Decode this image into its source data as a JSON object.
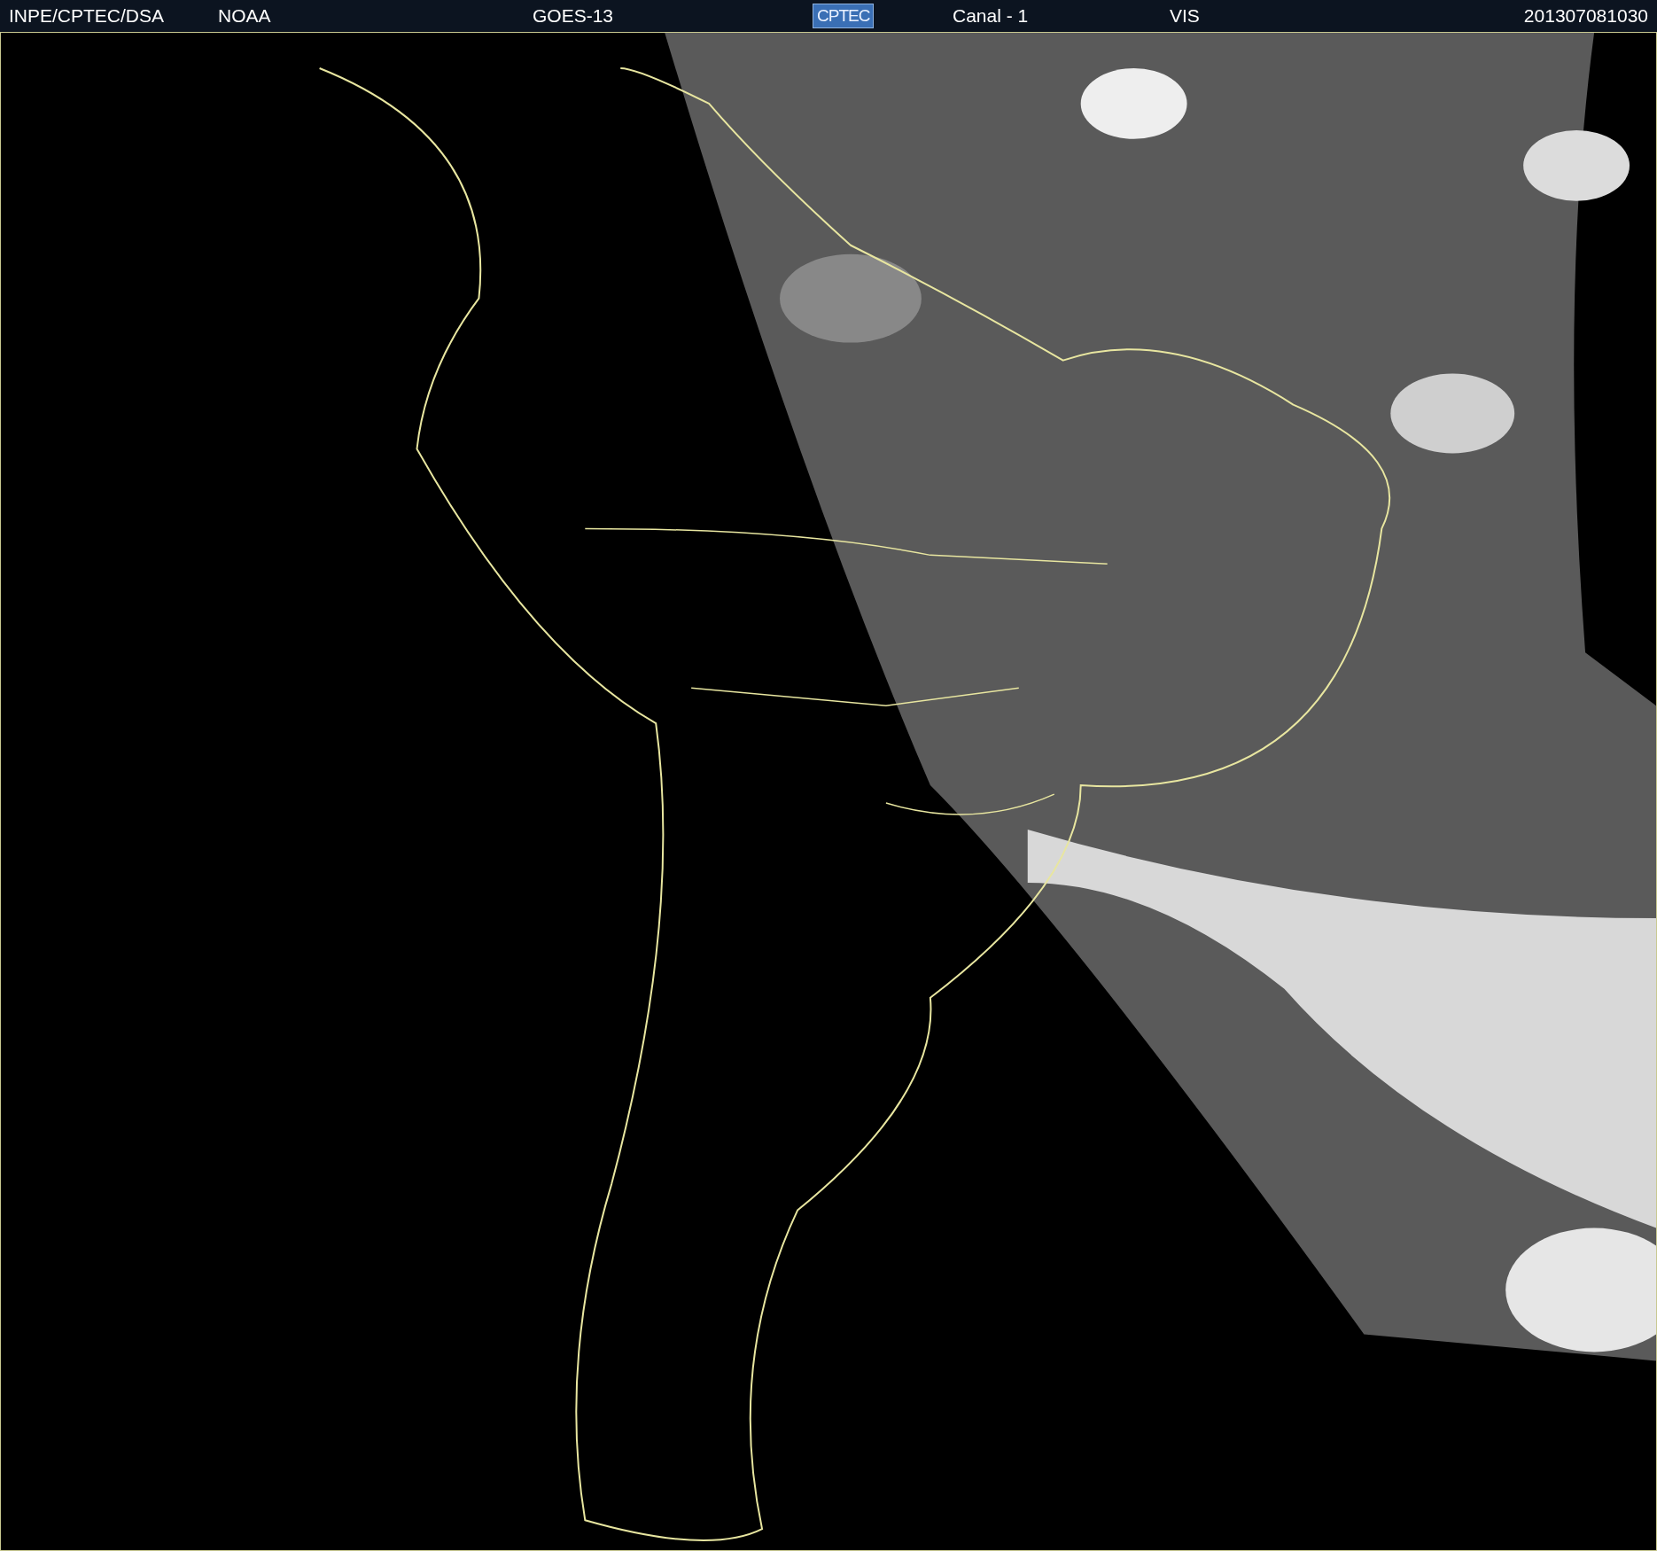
{
  "header": {
    "items": [
      {
        "kind": "text",
        "text": "INPE/CPTEC/DSA"
      },
      {
        "kind": "text",
        "text": "NOAA"
      },
      {
        "kind": "text",
        "text": "GOES-13"
      },
      {
        "kind": "logo",
        "text": "CPTEC"
      },
      {
        "kind": "text",
        "text": "Canal - 1"
      },
      {
        "kind": "text",
        "text": "VIS"
      },
      {
        "kind": "text",
        "text": "201307081030"
      }
    ]
  }
}
